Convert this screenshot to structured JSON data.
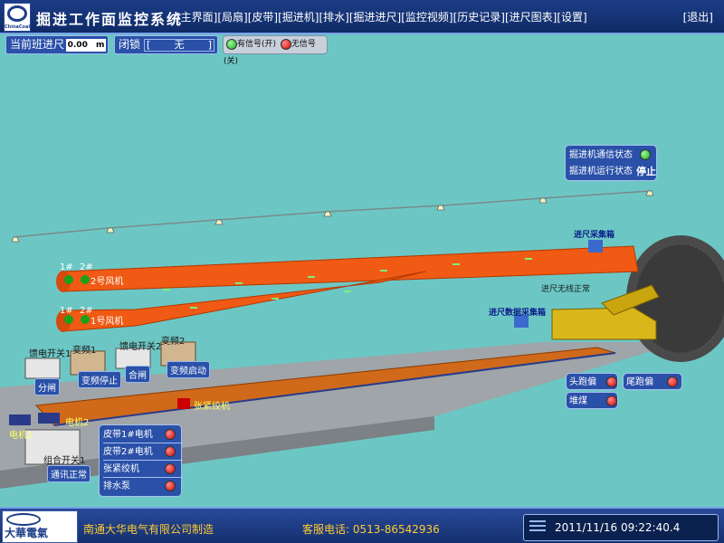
{
  "header": {
    "logo_caption": "ChinaCoal",
    "title": "掘进工作面监控系统",
    "menu": [
      "[主界面]",
      "[局扇]",
      "[皮带]",
      "[掘进机]",
      "[排水]",
      "[掘进进尺]",
      "[监控视频]",
      "[历史记录]",
      "[进尺图表]",
      "[设置]"
    ],
    "exit": "[退出]"
  },
  "status": {
    "distance_label": "当前班进尺",
    "distance_value": "0.00",
    "distance_unit": "m",
    "lock_label": "闭锁",
    "lock_value": "无",
    "legend_on": "有信号(开)",
    "legend_off": "无信号(关)"
  },
  "scene": {
    "fan2_label": "2号风机",
    "fan1_label": "1号风机",
    "fan_num_1": "1#",
    "fan_num_2": "2#",
    "switch1_label": "馈电开关1",
    "vfd1_label": "变频1",
    "switch2_label": "馈电开关2",
    "vfd2_label": "变频2",
    "btn_open": "分闸",
    "btn_vfd_stop": "变频停止",
    "btn_close": "合闸",
    "btn_vfd_start": "变频启动",
    "tension_label": "张紧绞机",
    "motor1_label": "电机1",
    "motor2_label": "电机2",
    "combo_switch_label": "组合开关1",
    "comm_ok_label": "通讯正常",
    "collector_label": "进尺采集箱",
    "wireless_label": "进尺无线正常",
    "data_box_label": "进尺数据采集箱"
  },
  "machine_panel": {
    "comm_label": "掘进机通信状态",
    "comm_state": "on",
    "run_label": "掘进机运行状态",
    "run_value": "停止"
  },
  "belt_panel": {
    "items": [
      {
        "label": "皮带1#电机",
        "state": "off"
      },
      {
        "label": "皮带2#电机",
        "state": "off"
      },
      {
        "label": "张紧绞机",
        "state": "off"
      },
      {
        "label": "排水泵",
        "state": "off"
      }
    ]
  },
  "deviation_panel": {
    "head_label": "头跑偏",
    "tail_label": "尾跑偏",
    "coal_label": "堆煤"
  },
  "footer": {
    "company": "南通大华电气有限公司制造",
    "service": "客服电话:  0513-86542936",
    "logo_text": "大華電氣",
    "datetime": "2011/11/16  09:22:40.4"
  },
  "colors": {
    "background": "#6cc7c4",
    "panel_blue": "#2a50a8",
    "duct_orange": "#f05a14",
    "status_on": "#1ca31c",
    "status_off": "#d00000"
  }
}
